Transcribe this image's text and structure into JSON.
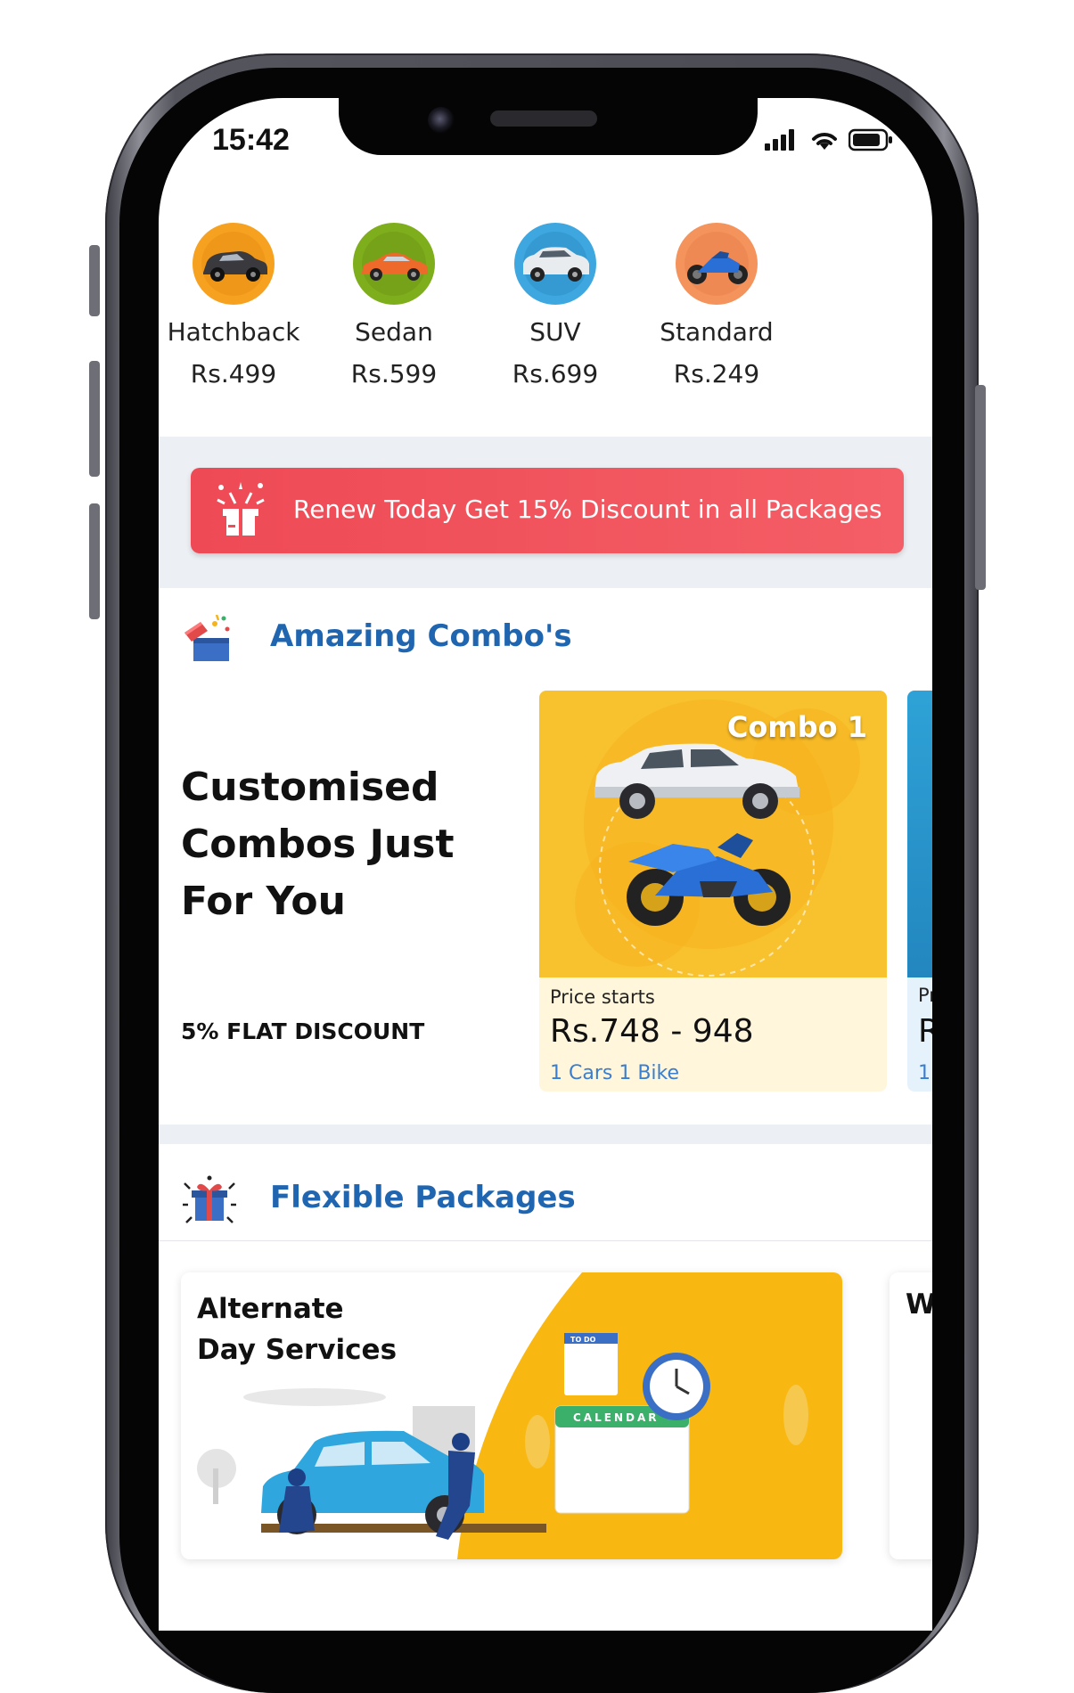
{
  "status_bar": {
    "time": "15:42"
  },
  "vehicles": [
    {
      "name": "Hatchback",
      "price": "Rs.499",
      "icon": "hatchback-car-icon",
      "color": "#f7a121"
    },
    {
      "name": "Sedan",
      "price": "Rs.599",
      "icon": "sedan-car-icon",
      "color": "#7fae1c"
    },
    {
      "name": "SUV",
      "price": "Rs.699",
      "icon": "suv-car-icon",
      "color": "#3ea7df"
    },
    {
      "name": "Standard",
      "price": "Rs.249",
      "icon": "motorbike-icon",
      "color": "#f4935c"
    }
  ],
  "promo": {
    "text": "Renew Today Get 15% Discount in all Packages",
    "icon": "gift-burst-icon",
    "color": "#ef4d57"
  },
  "combos": {
    "title": "Amazing Combo's",
    "icon": "open-gift-box-icon",
    "tagline": "Customised Combos Just For You",
    "discount": "5% FLAT DISCOUNT",
    "cards": [
      {
        "label": "Combo 1",
        "price_label": "Price starts",
        "price": "Rs.748 - 948",
        "detail": "1 Cars 1 Bike"
      },
      {
        "price_label": "Pr",
        "price": "R",
        "detail": "1"
      }
    ]
  },
  "flexible": {
    "title": "Flexible Packages",
    "icon": "gift-celebration-icon",
    "cards": [
      {
        "title_line1": "Alternate",
        "title_line2": "Day Services"
      },
      {
        "title_line1": "W"
      }
    ],
    "illustration_text": {
      "todo": "TO DO",
      "calendar": "CALENDAR"
    }
  }
}
